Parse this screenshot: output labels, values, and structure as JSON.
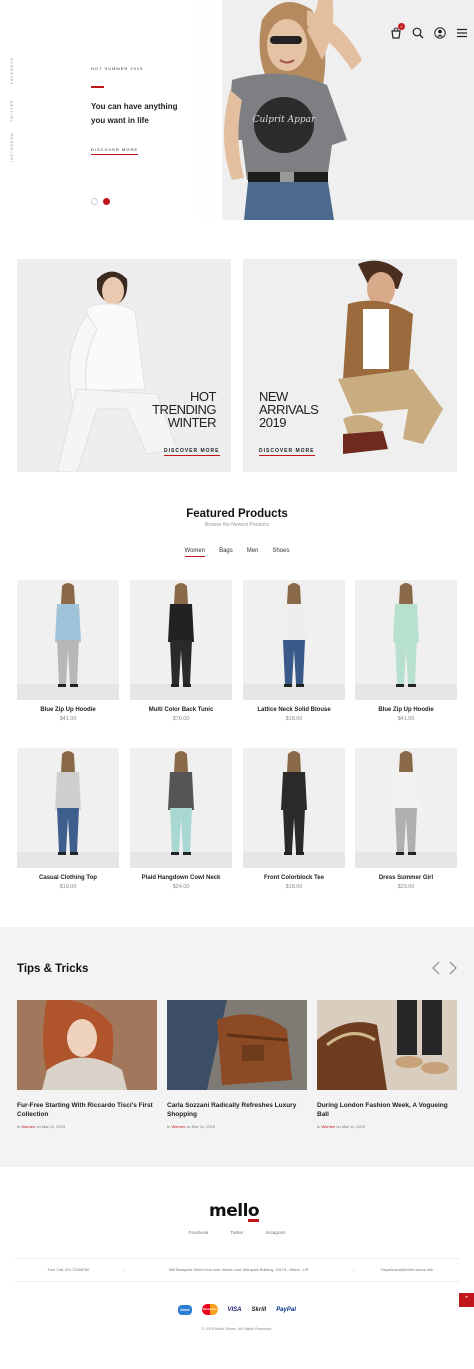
{
  "header": {
    "logo_prefix": "mell",
    "logo_o": "o",
    "cart_count": "0"
  },
  "hero": {
    "side_links": [
      "FACEBOOK",
      "TWITTER",
      "INSTAGRAM"
    ],
    "small": "HOT SUMMER 2019",
    "title_line1": "You can have anything",
    "title_line2": "you want in life",
    "button": "DISCOVER MORE",
    "tshirt_text": "Culprit Appar"
  },
  "banners": [
    {
      "title_lines": [
        "HOT",
        "TRENDING",
        "WINTER"
      ],
      "button": "DISCOVER MORE"
    },
    {
      "title_lines": [
        "NEW",
        "ARRIVALS",
        "2019"
      ],
      "button": "DISCOVER MORE"
    }
  ],
  "featured": {
    "title": "Featured Products",
    "subtitle": "Browse the Newest Products",
    "tabs": [
      "Women",
      "Bags",
      "Men",
      "Shoes"
    ],
    "active_tab": 0,
    "products": [
      {
        "name": "Blue Zip Up Hoodie",
        "price": "$41.00"
      },
      {
        "name": "Multi Color Back Tunic",
        "price": "$70.00"
      },
      {
        "name": "Lattice Neck Solid Blouse",
        "price": "$18.00"
      },
      {
        "name": "Blue Zip Up Hoodie",
        "price": "$41.00"
      },
      {
        "name": "Casual Clothing Top",
        "price": "$19.00"
      },
      {
        "name": "Plaid Hangdown Cowl Neck",
        "price": "$24.00"
      },
      {
        "name": "Front Colorblock Tee",
        "price": "$18.00"
      },
      {
        "name": "Dress Summer Girl",
        "price": "$23.00"
      }
    ]
  },
  "tips": {
    "title": "Tips & Tricks",
    "posts": [
      {
        "title": "Fur-Free Starting With Riccardo Tisci's First Collection",
        "in": "In",
        "category": "Women",
        "on": "on",
        "date": "Mar 11, 2019"
      },
      {
        "title": "Carla Sozzani Radically Refreshes Luxury Shopping",
        "in": "In",
        "category": "Women",
        "on": "on",
        "date": "Mar 11, 2019"
      },
      {
        "title": "During London Fashion Week, A Vogueing Ball",
        "in": "In",
        "category": "Women",
        "on": "on",
        "date": "Mar 11, 2019"
      }
    ]
  },
  "footer": {
    "links": [
      "Facebook",
      "Twitter",
      "Instagram"
    ],
    "phone": "Free Call: 001 22456760",
    "address": "586 Banquest Street from near desert road, Marquain Building, 33175 - Miami - US",
    "email": "Department@boller-stores.info",
    "payments": [
      "Amex",
      "Mastercard",
      "VISA",
      "Skrill",
      "PayPal"
    ],
    "copyright": "© 2019 Mello Stores. All Rights Reserved."
  },
  "colors": {
    "accent": "#c0151b",
    "text": "#222222",
    "tips_bg": "#f3f3f3"
  }
}
